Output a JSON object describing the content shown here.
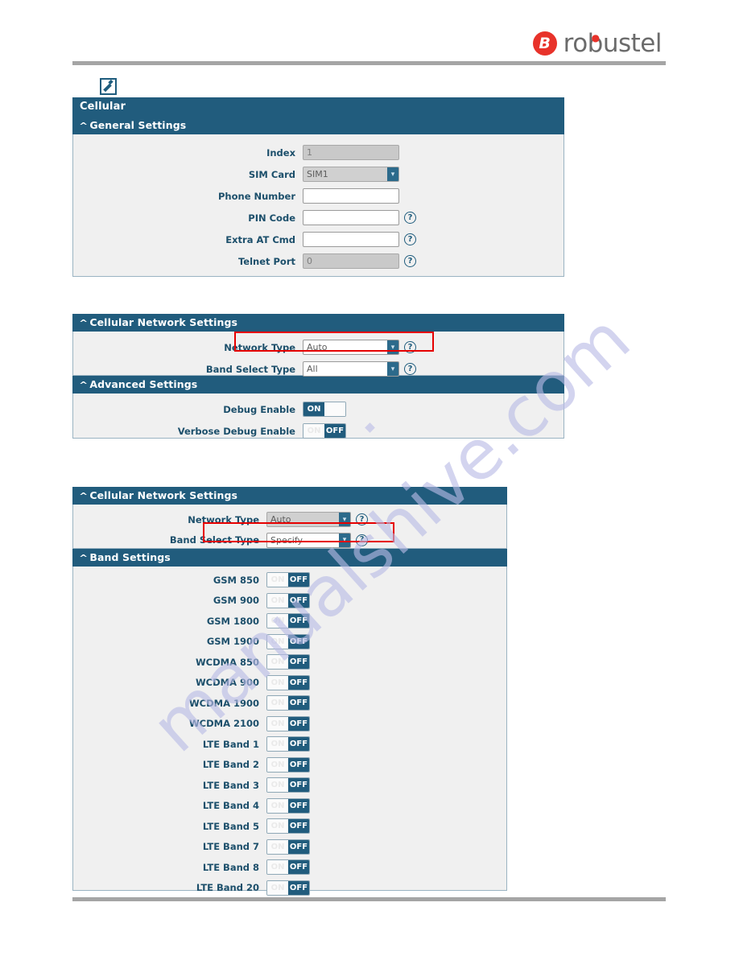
{
  "brand": {
    "name": "robustel",
    "logo_glyph": "B",
    "logo_color": "#e8322a",
    "text_color": "#6b6b6b"
  },
  "watermark": {
    "text": "manualshive.com",
    "color": "#b9bbe6"
  },
  "theme": {
    "header_bar": "#215c7d",
    "label_color": "#1c4f6b",
    "panel_bg": "#f0f0f0",
    "highlight": "#e60000",
    "toggle_on": "#215c7d"
  },
  "icons": {
    "edit": "edit-icon",
    "help": "?",
    "collapse_caret": "˄",
    "dropdown_caret": "˅"
  },
  "section1": {
    "title": "Cellular",
    "group_label": "General Settings",
    "rows": [
      {
        "label": "Index",
        "type": "text",
        "value": "1",
        "disabled": true,
        "help": false
      },
      {
        "label": "SIM Card",
        "type": "select",
        "value": "SIM1",
        "disabled": true,
        "help": false
      },
      {
        "label": "Phone Number",
        "type": "text",
        "value": "",
        "disabled": false,
        "help": false
      },
      {
        "label": "PIN Code",
        "type": "text",
        "value": "",
        "disabled": false,
        "help": true
      },
      {
        "label": "Extra AT Cmd",
        "type": "text",
        "value": "",
        "disabled": false,
        "help": true
      },
      {
        "label": "Telnet Port",
        "type": "text",
        "value": "0",
        "disabled": true,
        "help": true
      }
    ]
  },
  "section2": {
    "network_group_label": "Cellular Network Settings",
    "network_rows": [
      {
        "label": "Network Type",
        "value": "Auto",
        "help": true,
        "highlighted": true
      },
      {
        "label": "Band Select Type",
        "value": "All",
        "help": true,
        "highlighted": false
      }
    ],
    "advanced_group_label": "Advanced Settings",
    "advanced_rows": [
      {
        "label": "Debug Enable",
        "state": "ON"
      },
      {
        "label": "Verbose Debug Enable",
        "state": "OFF"
      }
    ]
  },
  "section3": {
    "network_group_label": "Cellular Network Settings",
    "network_rows": [
      {
        "label": "Network Type",
        "value": "Auto",
        "help": true,
        "disabled": true,
        "highlighted": false
      },
      {
        "label": "Band Select Type",
        "value": "Specify",
        "help": true,
        "disabled": false,
        "highlighted": true
      }
    ],
    "band_group_label": "Band Settings",
    "bands": [
      {
        "label": "GSM 850",
        "state": "OFF"
      },
      {
        "label": "GSM 900",
        "state": "OFF"
      },
      {
        "label": "GSM 1800",
        "state": "OFF"
      },
      {
        "label": "GSM 1900",
        "state": "OFF"
      },
      {
        "label": "WCDMA 850",
        "state": "OFF"
      },
      {
        "label": "WCDMA 900",
        "state": "OFF"
      },
      {
        "label": "WCDMA 1900",
        "state": "OFF"
      },
      {
        "label": "WCDMA 2100",
        "state": "OFF"
      },
      {
        "label": "LTE Band 1",
        "state": "OFF"
      },
      {
        "label": "LTE Band 2",
        "state": "OFF"
      },
      {
        "label": "LTE Band 3",
        "state": "OFF"
      },
      {
        "label": "LTE Band 4",
        "state": "OFF"
      },
      {
        "label": "LTE Band 5",
        "state": "OFF"
      },
      {
        "label": "LTE Band 7",
        "state": "OFF"
      },
      {
        "label": "LTE Band 8",
        "state": "OFF"
      },
      {
        "label": "LTE Band 20",
        "state": "OFF"
      }
    ]
  }
}
